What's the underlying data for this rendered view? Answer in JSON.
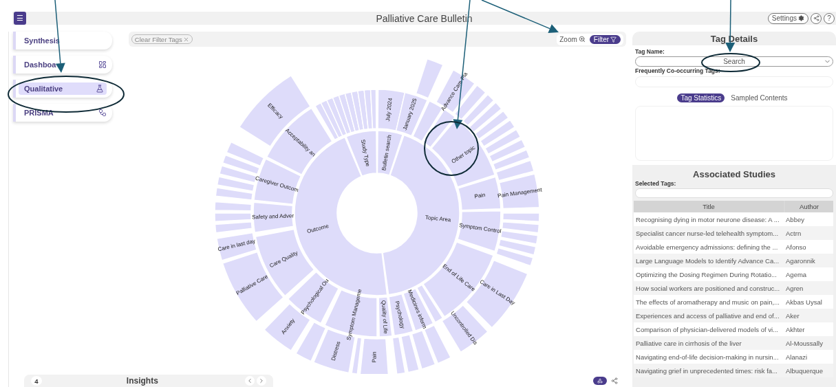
{
  "header": {
    "menu_label": "☰",
    "title": "Palliative Care Bulletin",
    "settings": "Settings",
    "help": "?"
  },
  "sidebar": {
    "items": [
      {
        "label": "Synthesis",
        "selected": false
      },
      {
        "label": "Dashboa",
        "selected": false
      },
      {
        "label": "Qualitative",
        "selected": true
      },
      {
        "label": "PRISMA",
        "selected": false
      }
    ]
  },
  "toolbar": {
    "clear_chip": "Clear Filter Tags",
    "zoom": "Zoom",
    "filter": "Filter"
  },
  "sunburst": {
    "labels": [
      "Outcome",
      "Study Type",
      "Bulletin search",
      "Topic Area",
      "July 2024",
      "January 2025",
      "Other topic",
      "Pain",
      "Symptom Control",
      "End of Life Care",
      "Medicines inform",
      "Psychology",
      "Quality of Life",
      "Symptom Manageme",
      "Psychological Ou",
      "Care Quality",
      "Safety and Adver",
      "Caregiver Outcom",
      "Acceptability an",
      "Advance Care Pla",
      "Pain Management",
      "Care in Last Day",
      "Uncontrolled Dis",
      "Pain",
      "Distress",
      "Anxiety",
      "Palliative Care",
      "Care in last day",
      "Efficacy"
    ]
  },
  "insights": {
    "count": "4",
    "title": "Insights"
  },
  "tag_details": {
    "title": "Tag Details",
    "tag_name_label": "Tag Name:",
    "search_placeholder": "Search",
    "cooccurring_label": "Frequently Co-occurring Tags:",
    "tabs": [
      {
        "label": "Tag Statistics",
        "selected": true
      },
      {
        "label": "Sampled Contents",
        "selected": false
      }
    ]
  },
  "associated_studies": {
    "title": "Associated Studies",
    "selected_tags_label": "Selected Tags:",
    "columns": [
      "Title",
      "Author"
    ],
    "rows": [
      [
        "Recognising dying in motor neurone disease: A ...",
        "Abbey"
      ],
      [
        "Specialist cancer nurse-led telehealth symptom...",
        "Actrn"
      ],
      [
        "Avoidable emergency admissions: defining the ...",
        "Afonso"
      ],
      [
        "Large Language Models to Identify Advance Ca...",
        "Agaronnik"
      ],
      [
        "Optimizing the Dosing Regimen During Rotatio...",
        "Agema"
      ],
      [
        "How social workers are positioned and construc...",
        "Agren"
      ],
      [
        "The effects of aromatherapy and music on pain,...",
        "Akbas Uysal"
      ],
      [
        "Experiences and access of palliative and end of...",
        "Aker"
      ],
      [
        "Comparison of physician-delivered models of vi...",
        "Akhter"
      ],
      [
        "Palliative care in cirrhosis of the liver",
        "Al-Moussally"
      ],
      [
        "Navigating end-of-life decision-making in nursin...",
        "Alanazi"
      ],
      [
        "Navigating grief in unprecedented times: risk fa...",
        "Albuquerque"
      ]
    ]
  }
}
